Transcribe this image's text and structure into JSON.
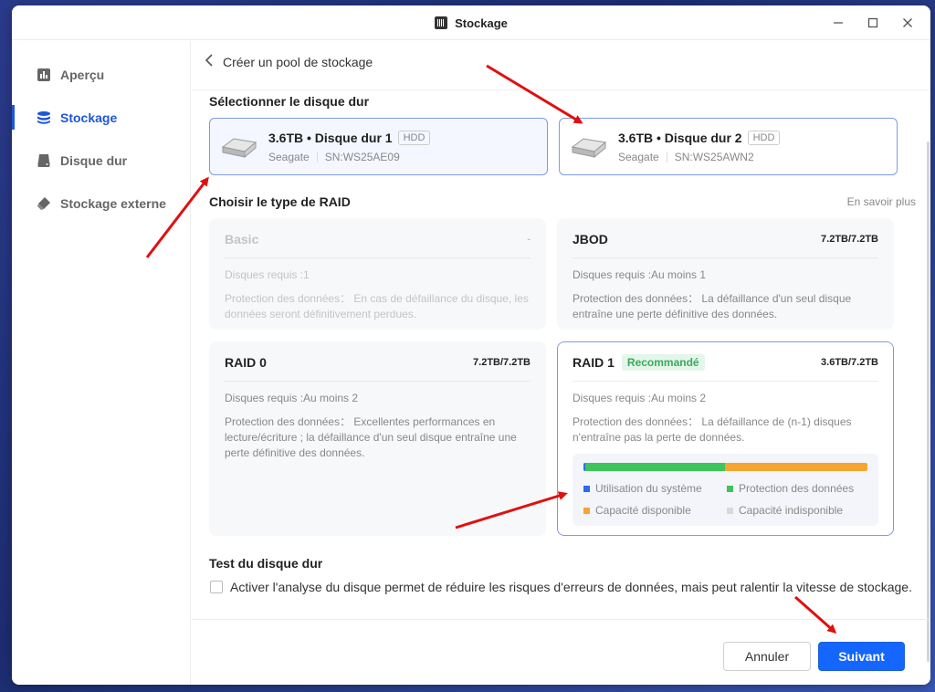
{
  "window": {
    "title": "Stockage"
  },
  "sidebar": {
    "items": [
      {
        "label": "Aperçu",
        "icon": "chart-icon",
        "active": false
      },
      {
        "label": "Stockage",
        "icon": "database-icon",
        "active": true
      },
      {
        "label": "Disque dur",
        "icon": "hard-drive-icon",
        "active": false
      },
      {
        "label": "Stockage externe",
        "icon": "usb-icon",
        "active": false
      }
    ]
  },
  "header": {
    "title": "Créer un pool de stockage"
  },
  "disk_section": {
    "title": "Sélectionner le disque dur",
    "disks": [
      {
        "name": "3.6TB • Disque dur 1",
        "type": "HDD",
        "brand": "Seagate",
        "serial": "SN:WS25AE09",
        "selected": true
      },
      {
        "name": "3.6TB • Disque dur 2",
        "type": "HDD",
        "brand": "Seagate",
        "serial": "SN:WS25AWN2",
        "selected": true
      }
    ]
  },
  "raid_section": {
    "title": "Choisir le type de RAID",
    "learn_more": "En savoir plus",
    "options": [
      {
        "name": "Basic",
        "capacity": "-",
        "disks": "Disques requis :1",
        "protection": "Protection des données： En cas de défaillance du disque, les données seront définitivement perdues.",
        "disabled": true,
        "selected": false
      },
      {
        "name": "JBOD",
        "capacity": "7.2TB/7.2TB",
        "disks": "Disques requis :Au moins 1",
        "protection": "Protection des données： La défaillance d'un seul disque entraîne une perte définitive des données.",
        "disabled": false,
        "selected": false
      },
      {
        "name": "RAID 0",
        "capacity": "7.2TB/7.2TB",
        "disks": "Disques requis :Au moins 2",
        "protection": "Protection des données： Excellentes performances en lecture/écriture ; la défaillance d'un seul disque entraîne une perte définitive des données.",
        "disabled": false,
        "selected": false
      },
      {
        "name": "RAID 1",
        "badge": "Recommandé",
        "capacity": "3.6TB/7.2TB",
        "disks": "Disques requis :Au moins 2",
        "protection": "Protection des données： La défaillance de (n-1) disques n'entraîne pas la perte de données.",
        "disabled": false,
        "selected": true
      }
    ],
    "capacity_usage": {
      "system_fraction": 0.005,
      "protection_fraction": 0.495,
      "available_fraction": 0.5,
      "legend": [
        "Utilisation du système",
        "Protection des données",
        "Capacité disponible",
        "Capacité indisponible"
      ],
      "colors": {
        "system": "#2a6de8",
        "protection": "#3dc45b",
        "available": "#f5a530",
        "unavailable": "#d8d8d8"
      }
    }
  },
  "test_section": {
    "title": "Test du disque dur",
    "checkbox_label": "Activer l'analyse du disque permet de réduire les risques d'erreurs de données, mais peut ralentir la vitesse de stockage.",
    "checked": false
  },
  "footer": {
    "cancel": "Annuler",
    "next": "Suivant"
  },
  "colors": {
    "accent": "#1466ff",
    "annotation_arrow": "#e01010"
  }
}
